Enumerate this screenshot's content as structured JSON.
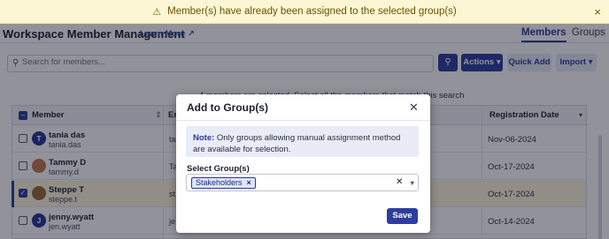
{
  "banner": {
    "icon": "warning-icon",
    "message": "Member(s) have already been assigned to the selected group(s)",
    "close_glyph": "×"
  },
  "header": {
    "title": "Workspace Member Management",
    "learn_more": "Learn More",
    "tabs": [
      {
        "label": "Members",
        "active": true
      },
      {
        "label": "Groups",
        "active": false
      }
    ]
  },
  "toolbar": {
    "search_placeholder": "Search for members...",
    "actions_label": "Actions",
    "quick_add_label": "Quick Add",
    "import_label": "Import"
  },
  "selection_info": "4 members are selected. Select all the members that match this search",
  "table": {
    "columns": [
      "Member",
      "Em",
      "Registration Date"
    ],
    "rows": [
      {
        "initial": "T",
        "name": "tania das",
        "username": "tania.das",
        "email": "ta",
        "date": "Nov-06-2024",
        "checked": false,
        "photo": false
      },
      {
        "initial": "",
        "name": "Tammy D",
        "username": "tammy.d",
        "email": "Ta",
        "date": "Oct-17-2024",
        "checked": false,
        "photo": true
      },
      {
        "initial": "",
        "name": "Steppe T",
        "username": "steppe.t",
        "email": "st",
        "date": "Oct-17-2024",
        "checked": true,
        "photo": true
      },
      {
        "initial": "J",
        "name": "jenny.wyatt",
        "username": "jen.wyatt",
        "email": "je",
        "date": "Oct-14-2024",
        "checked": false,
        "photo": false
      }
    ]
  },
  "modal": {
    "title": "Add to Group(s)",
    "note_label": "Note:",
    "note_text": "Only groups allowing manual assignment method are available for selection.",
    "select_label": "Select Group(s)",
    "selected_groups": [
      "Stakeholders"
    ],
    "save_label": "Save"
  },
  "colors": {
    "primary": "#2d3e9e",
    "banner_bg": "#fdf6d4",
    "selected_row": "#fff8dc"
  }
}
